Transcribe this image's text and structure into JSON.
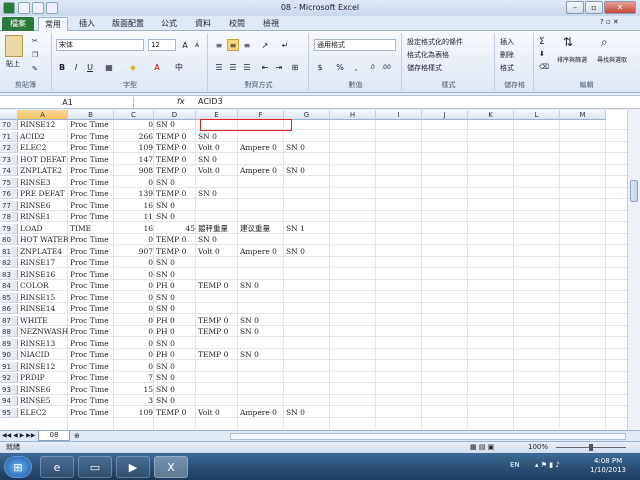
{
  "window": {
    "title": "08 - Microsoft Excel"
  },
  "tabs": [
    "檔案",
    "常用",
    "插入",
    "版面配置",
    "公式",
    "資料",
    "校閱",
    "檢視"
  ],
  "ribbon": {
    "clipboard": {
      "paste": "貼上",
      "label": "剪貼簿"
    },
    "font": {
      "name": "宋体",
      "size": "12",
      "bold": "B",
      "italic": "I",
      "underline": "U",
      "label": "字型"
    },
    "alignment": {
      "label": "對齊方式"
    },
    "number": {
      "format": "通用格式",
      "currency": "$",
      "percent": "%",
      "comma": ",",
      "label": "數值"
    },
    "styles": {
      "conditional": "設定格式化的條件",
      "table": "格式化為表格",
      "cell": "儲存格樣式",
      "label": "樣式"
    },
    "cells": {
      "insert": "插入",
      "delete": "刪除",
      "format": "格式",
      "label": "儲存格"
    },
    "editing": {
      "sum": "Σ",
      "sort": "排序與篩選",
      "find": "尋找與選取",
      "label": "編輯"
    }
  },
  "formula_bar": {
    "name_box": "A1",
    "fx": "fx",
    "value": "ACID3"
  },
  "columns": [
    "A",
    "B",
    "C",
    "D",
    "E",
    "F",
    "G",
    "H",
    "I",
    "J",
    "K",
    "L",
    "M"
  ],
  "rows": [
    {
      "n": "70",
      "a": "RINSE12",
      "b": "Proc Time",
      "c": "0",
      "d": "SN 0",
      "e": "",
      "f": "",
      "g": ""
    },
    {
      "n": "71",
      "a": "ACID2",
      "b": "Proc Time",
      "c": "266",
      "d": "TEMP 0",
      "e": "SN 0",
      "f": "",
      "g": ""
    },
    {
      "n": "72",
      "a": "ELEC2",
      "b": "Proc Time",
      "c": "109",
      "d": "TEMP 0",
      "e": "Volt 0",
      "f": "Ampere 0",
      "g": "SN 0"
    },
    {
      "n": "73",
      "a": "HOT DEFAT",
      "b": "Proc Time",
      "c": "147",
      "d": "TEMP 0",
      "e": "SN 0",
      "f": "",
      "g": ""
    },
    {
      "n": "74",
      "a": "ZNPLATE2",
      "b": "Proc Time",
      "c": "908",
      "d": "TEMP 0",
      "e": "Volt 0",
      "f": "Ampere 0",
      "g": "SN 0"
    },
    {
      "n": "75",
      "a": "RINSE3",
      "b": "Proc Time",
      "c": "0",
      "d": "SN 0",
      "e": "",
      "f": "",
      "g": ""
    },
    {
      "n": "76",
      "a": "PRE DEFAT",
      "b": "Proc Time",
      "c": "139",
      "d": "TEMP 0",
      "e": "SN 0",
      "f": "",
      "g": ""
    },
    {
      "n": "77",
      "a": "RINSE6",
      "b": "Proc Time",
      "c": "16",
      "d": "SN 0",
      "e": "",
      "f": "",
      "g": ""
    },
    {
      "n": "78",
      "a": "RINSE1",
      "b": "Proc Time",
      "c": "11",
      "d": "SN 0",
      "e": "",
      "f": "",
      "g": ""
    },
    {
      "n": "79",
      "a": "LOAD",
      "b": "TIME",
      "c": "16",
      "d": "45",
      "e": "鍍秤重量",
      "f": "建议重量",
      "g": "SN 1"
    },
    {
      "n": "80",
      "a": "HOT WATER",
      "b": "Proc Time",
      "c": "0",
      "d": "TEMP 0",
      "e": "SN 0",
      "f": "",
      "g": ""
    },
    {
      "n": "81",
      "a": "ZNPLATE4",
      "b": "Proc Time",
      "c": "907",
      "d": "TEMP 0",
      "e": "Volt 0",
      "f": "Ampere 0",
      "g": "SN 0"
    },
    {
      "n": "82",
      "a": "RINSE17",
      "b": "Proc Time",
      "c": "0",
      "d": "SN 0",
      "e": "",
      "f": "",
      "g": ""
    },
    {
      "n": "83",
      "a": "RINSE16",
      "b": "Proc Time",
      "c": "0",
      "d": "SN 0",
      "e": "",
      "f": "",
      "g": ""
    },
    {
      "n": "84",
      "a": "COLOR",
      "b": "Proc Time",
      "c": "0",
      "d": "PH 0",
      "e": "TEMP 0",
      "f": "SN 0",
      "g": ""
    },
    {
      "n": "85",
      "a": "RINSE15",
      "b": "Proc Time",
      "c": "0",
      "d": "SN 0",
      "e": "",
      "f": "",
      "g": ""
    },
    {
      "n": "86",
      "a": "RINSE14",
      "b": "Proc Time",
      "c": "0",
      "d": "SN 0",
      "e": "",
      "f": "",
      "g": ""
    },
    {
      "n": "87",
      "a": "WHITE",
      "b": "Proc Time",
      "c": "0",
      "d": "PH 0",
      "e": "TEMP 0",
      "f": "SN 0",
      "g": ""
    },
    {
      "n": "88",
      "a": "NEZNWASH",
      "b": "Proc Time",
      "c": "0",
      "d": "PH 0",
      "e": "TEMP 0",
      "f": "SN 0",
      "g": ""
    },
    {
      "n": "89",
      "a": "RINSE13",
      "b": "Proc Time",
      "c": "0",
      "d": "SN 0",
      "e": "",
      "f": "",
      "g": ""
    },
    {
      "n": "90",
      "a": "NIACID",
      "b": "Proc Time",
      "c": "0",
      "d": "PH 0",
      "e": "TEMP 0",
      "f": "SN 0",
      "g": ""
    },
    {
      "n": "91",
      "a": "RINSE12",
      "b": "Proc Time",
      "c": "0",
      "d": "SN 0",
      "e": "",
      "f": "",
      "g": ""
    },
    {
      "n": "92",
      "a": "PRDIP",
      "b": "Proc Time",
      "c": "7",
      "d": "SN 0",
      "e": "",
      "f": "",
      "g": ""
    },
    {
      "n": "93",
      "a": "RINSE6",
      "b": "Proc Time",
      "c": "15",
      "d": "SN 0",
      "e": "",
      "f": "",
      "g": ""
    },
    {
      "n": "94",
      "a": "RINSE5",
      "b": "Proc Time",
      "c": "3",
      "d": "SN 0",
      "e": "",
      "f": "",
      "g": ""
    },
    {
      "n": "95",
      "a": "ELEC2",
      "b": "Proc Time",
      "c": "109",
      "d": "TEMP 0",
      "e": "Volt 0",
      "f": "Ampere 0",
      "g": "SN 0"
    }
  ],
  "sheet": {
    "tab": "08"
  },
  "status": {
    "ready": "就緒",
    "zoom": "100%"
  },
  "taskbar": {
    "lang": "EN",
    "time": "4:08 PM",
    "date": "1/10/2013"
  },
  "colors": {
    "file_tab": "#2a7a3b",
    "highlight_box": "#dd2222"
  }
}
